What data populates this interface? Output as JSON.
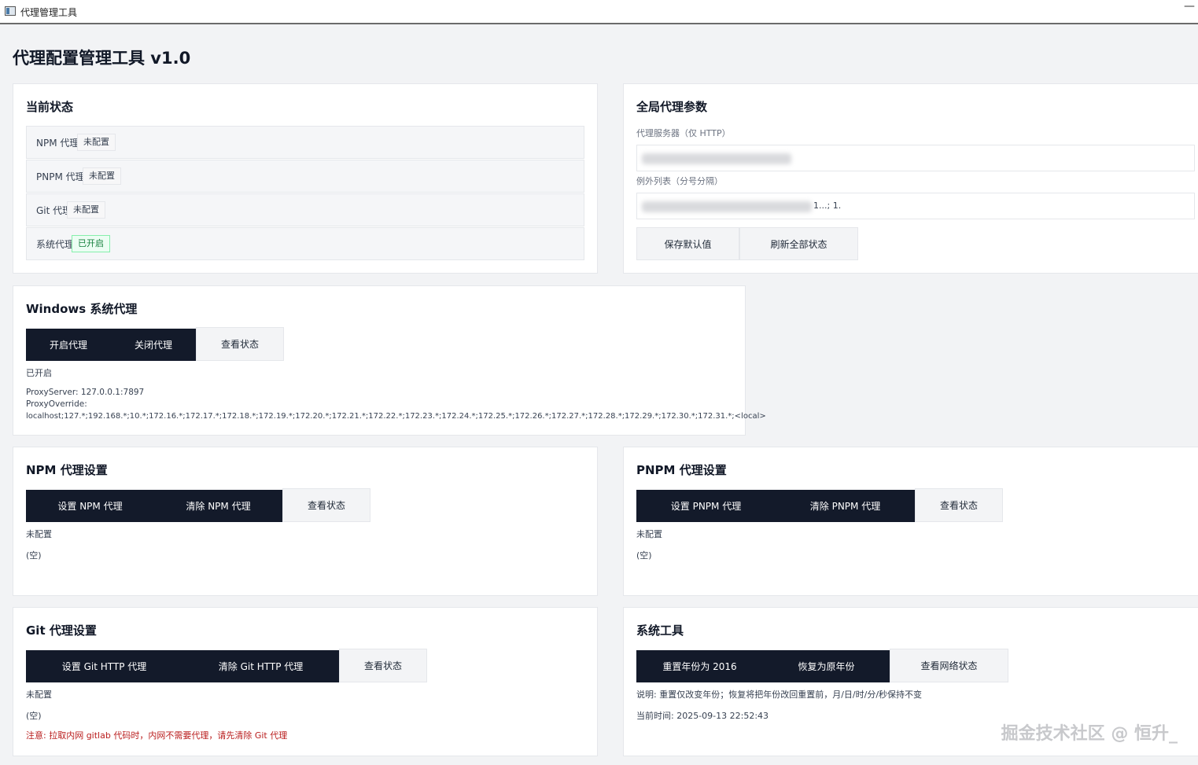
{
  "window": {
    "title": "代理管理工具",
    "minimize_glyph": "—"
  },
  "page_title": "代理配置管理工具 v1.0",
  "current_status": {
    "title": "当前状态",
    "rows": [
      {
        "label": "NPM 代理",
        "status": "未配置"
      },
      {
        "label": "PNPM 代理",
        "status": "未配置"
      },
      {
        "label": "Git 代理",
        "status": "未配置"
      },
      {
        "label": "系统代理",
        "status": "已开启"
      }
    ]
  },
  "global_params": {
    "title": "全局代理参数",
    "proxy_server_label": "代理服务器（仅 HTTP）",
    "exceptions_label": "例外列表（分号分隔）",
    "exceptions_tail": "1...; 1.",
    "save_default_button": "保存默认值",
    "refresh_all_button": "刷新全部状态"
  },
  "windows_proxy": {
    "title": "Windows 系统代理",
    "enable_button": "开启代理",
    "disable_button": "关闭代理",
    "check_button": "查看状态",
    "status_text": "已开启",
    "proxy_server_line": "ProxyServer: 127.0.0.1:7897",
    "proxy_override_label": "ProxyOverride:",
    "proxy_override_value": "localhost;127.*;192.168.*;10.*;172.16.*;172.17.*;172.18.*;172.19.*;172.20.*;172.21.*;172.22.*;172.23.*;172.24.*;172.25.*;172.26.*;172.27.*;172.28.*;172.29.*;172.30.*;172.31.*;<local>"
  },
  "npm": {
    "title": "NPM 代理设置",
    "set_button": "设置 NPM 代理",
    "clear_button": "清除 NPM 代理",
    "check_button": "查看状态",
    "status_text": "未配置",
    "output": "(空)"
  },
  "pnpm": {
    "title": "PNPM 代理设置",
    "set_button": "设置 PNPM 代理",
    "clear_button": "清除 PNPM 代理",
    "check_button": "查看状态",
    "status_text": "未配置",
    "output": "(空)"
  },
  "git": {
    "title": "Git 代理设置",
    "set_button": "设置 Git HTTP 代理",
    "clear_button": "清除 Git HTTP 代理",
    "check_button": "查看状态",
    "status_text": "未配置",
    "output": "(空)",
    "warning": "注意: 拉取内网 gitlab 代码时，内网不需要代理，请先清除 Git 代理"
  },
  "system_tools": {
    "title": "系统工具",
    "reset_year_button": "重置年份为 2016",
    "restore_year_button": "恢复为原年份",
    "network_status_button": "查看网络状态",
    "note": "说明: 重置仅改变年份；恢复将把年份改回重置前，月/日/时/分/秒保持不变",
    "current_time": "当前时间: 2025-09-13 22:52:43"
  },
  "watermark": "掘金技术社区 @ 恒升_"
}
